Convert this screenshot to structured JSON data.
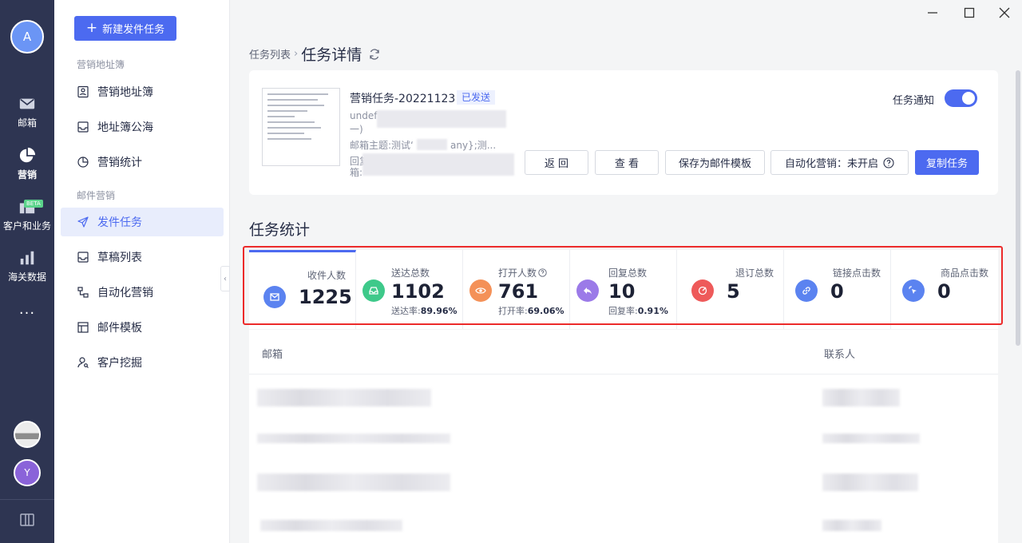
{
  "rail": {
    "avatar": "A",
    "items": [
      {
        "label": "邮箱",
        "icon": "mail-icon"
      },
      {
        "label": "营销",
        "icon": "pie-chart-icon"
      },
      {
        "label": "客户和业务",
        "icon": "customer-icon",
        "badge": "BETA"
      },
      {
        "label": "海关数据",
        "icon": "bar-chart-icon"
      }
    ],
    "more": "···",
    "user_avatar": "Y"
  },
  "sidenav": {
    "new_task": "新建发件任务",
    "section1": "营销地址簿",
    "items1": [
      "营销地址簿",
      "地址簿公海",
      "营销统计"
    ],
    "section2": "邮件营销",
    "items2": [
      "发件任务",
      "草稿列表",
      "自动化营销",
      "邮件模板",
      "客户挖掘"
    ]
  },
  "breadcrumb": {
    "parent": "任务列表",
    "current": "任务详情"
  },
  "task": {
    "name": "营销任务-20221123",
    "status": "已发送",
    "sender_line1": "undef",
    "sender_line2": "一)",
    "subject": "邮箱主题:测试ʻ",
    "subject_tail": "any};测...",
    "reply_line1": "回复",
    "reply_line2": "箱:",
    "notify_label": "任务通知",
    "notify_on": true,
    "buttons": {
      "back": "返 回",
      "view": "查 看",
      "save_template": "保存为邮件模板",
      "automation": "自动化营销：未开启",
      "copy": "复制任务"
    }
  },
  "stats": {
    "title": "任务统计",
    "items": [
      {
        "label": "收件人数",
        "value": "1225",
        "rate_label": "",
        "rate": "",
        "color": "#5b83f0"
      },
      {
        "label": "送达总数",
        "value": "1102",
        "rate_label": "送达率:",
        "rate": "89.96%",
        "color": "#3ec98a"
      },
      {
        "label": "打开人数",
        "value": "761",
        "rate_label": "打开率:",
        "rate": "69.06%",
        "color": "#f49158"
      },
      {
        "label": "回复总数",
        "value": "10",
        "rate_label": "回复率:",
        "rate": "0.91%",
        "color": "#9b7ae8"
      },
      {
        "label": "退订总数",
        "value": "5",
        "rate_label": "",
        "rate": "",
        "color": "#ee5a5a"
      },
      {
        "label": "链接点击数",
        "value": "0",
        "rate_label": "",
        "rate": "",
        "color": "#5b83f0"
      },
      {
        "label": "商品点击数",
        "value": "0",
        "rate_label": "",
        "rate": "",
        "color": "#5b83f0"
      }
    ]
  },
  "table": {
    "columns": [
      "邮箱",
      "联系人"
    ]
  }
}
